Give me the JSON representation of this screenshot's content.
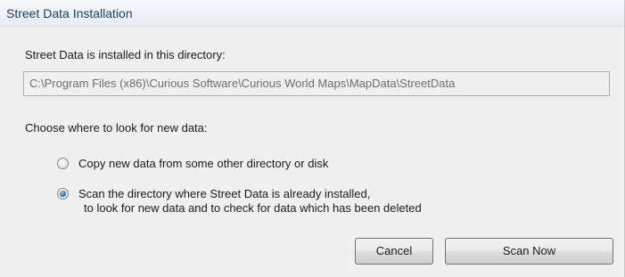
{
  "dialog": {
    "title": "Street Data Installation"
  },
  "install_dir": {
    "label": "Street Data is installed in this directory:",
    "path": "C:\\Program Files (x86)\\Curious Software\\Curious World Maps\\MapData\\StreetData"
  },
  "source": {
    "prompt": "Choose where to look for new data:",
    "options": [
      {
        "line1": "Copy new data from some other directory or disk",
        "line2": "",
        "checked": false
      },
      {
        "line1": "Scan the directory where Street Data is already installed,",
        "line2": "to look for new data and to check for data which has been deleted",
        "checked": true
      }
    ]
  },
  "buttons": {
    "cancel": "Cancel",
    "scan_now": "Scan Now"
  },
  "colors": {
    "dialog_background": "#f0f0f0",
    "title_text": "#1e395b",
    "disabled_text": "#6d6d6d",
    "radio_selected": "#2a73b8"
  }
}
